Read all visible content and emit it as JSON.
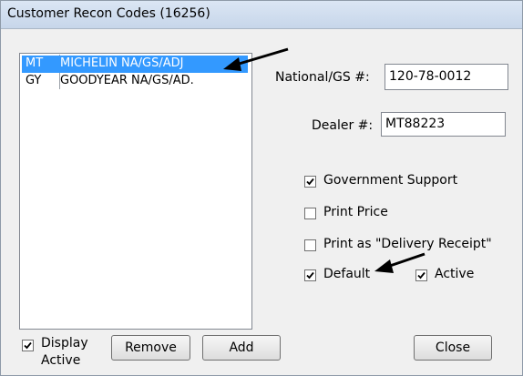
{
  "window": {
    "title": "Customer Recon Codes (16256)"
  },
  "list": {
    "rows": [
      {
        "code": "MT",
        "description": "MICHELIN NA/GS/ADJ",
        "selected": true
      },
      {
        "code": "GY",
        "description": "GOODYEAR NA/GS/AD.",
        "selected": false
      }
    ]
  },
  "fields": {
    "national_gs": {
      "label": "National/GS #:",
      "value": "120-78-0012"
    },
    "dealer": {
      "label": "Dealer #:",
      "value": "MT88223"
    }
  },
  "options": {
    "government_support": {
      "label": "Government Support",
      "checked": true
    },
    "print_price": {
      "label": "Print Price",
      "checked": false
    },
    "print_as_delivery_receipt": {
      "label": "Print as \"Delivery Receipt\"",
      "checked": false
    },
    "default": {
      "label": "Default",
      "checked": true
    },
    "active": {
      "label": "Active",
      "checked": true
    },
    "display_active": {
      "label": "Display Active",
      "checked": true
    }
  },
  "buttons": {
    "remove": "Remove",
    "add": "Add",
    "close": "Close"
  },
  "annotations": [
    "arrow-to-selected-row",
    "arrow-to-default-checkbox"
  ]
}
